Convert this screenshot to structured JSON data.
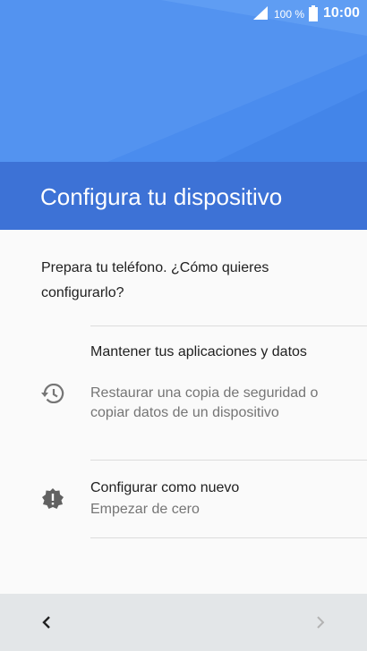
{
  "status_bar": {
    "battery_percent": "100 %",
    "time": "10:00",
    "signal_icon": "signal-icon",
    "battery_icon": "battery-icon"
  },
  "header": {
    "title": "Configura tu dispositivo"
  },
  "main": {
    "prompt": "Prepara tu teléfono. ¿Cómo quieres configurarlo?",
    "options": [
      {
        "icon": "restore-history-icon",
        "title": "Mantener tus aplicaciones y datos",
        "subtitle": "Restaurar una copia de seguridad o copiar datos de un dispositivo"
      },
      {
        "icon": "new-device-badge-icon",
        "title": "Configurar como nuevo",
        "subtitle": "Empezar de cero"
      }
    ]
  },
  "nav": {
    "back_icon": "chevron-left-icon",
    "next_icon": "chevron-right-icon"
  },
  "colors": {
    "hero": "#4e8ff0",
    "title_band": "#3d72d6",
    "nav_bar": "#e3e6e8"
  }
}
